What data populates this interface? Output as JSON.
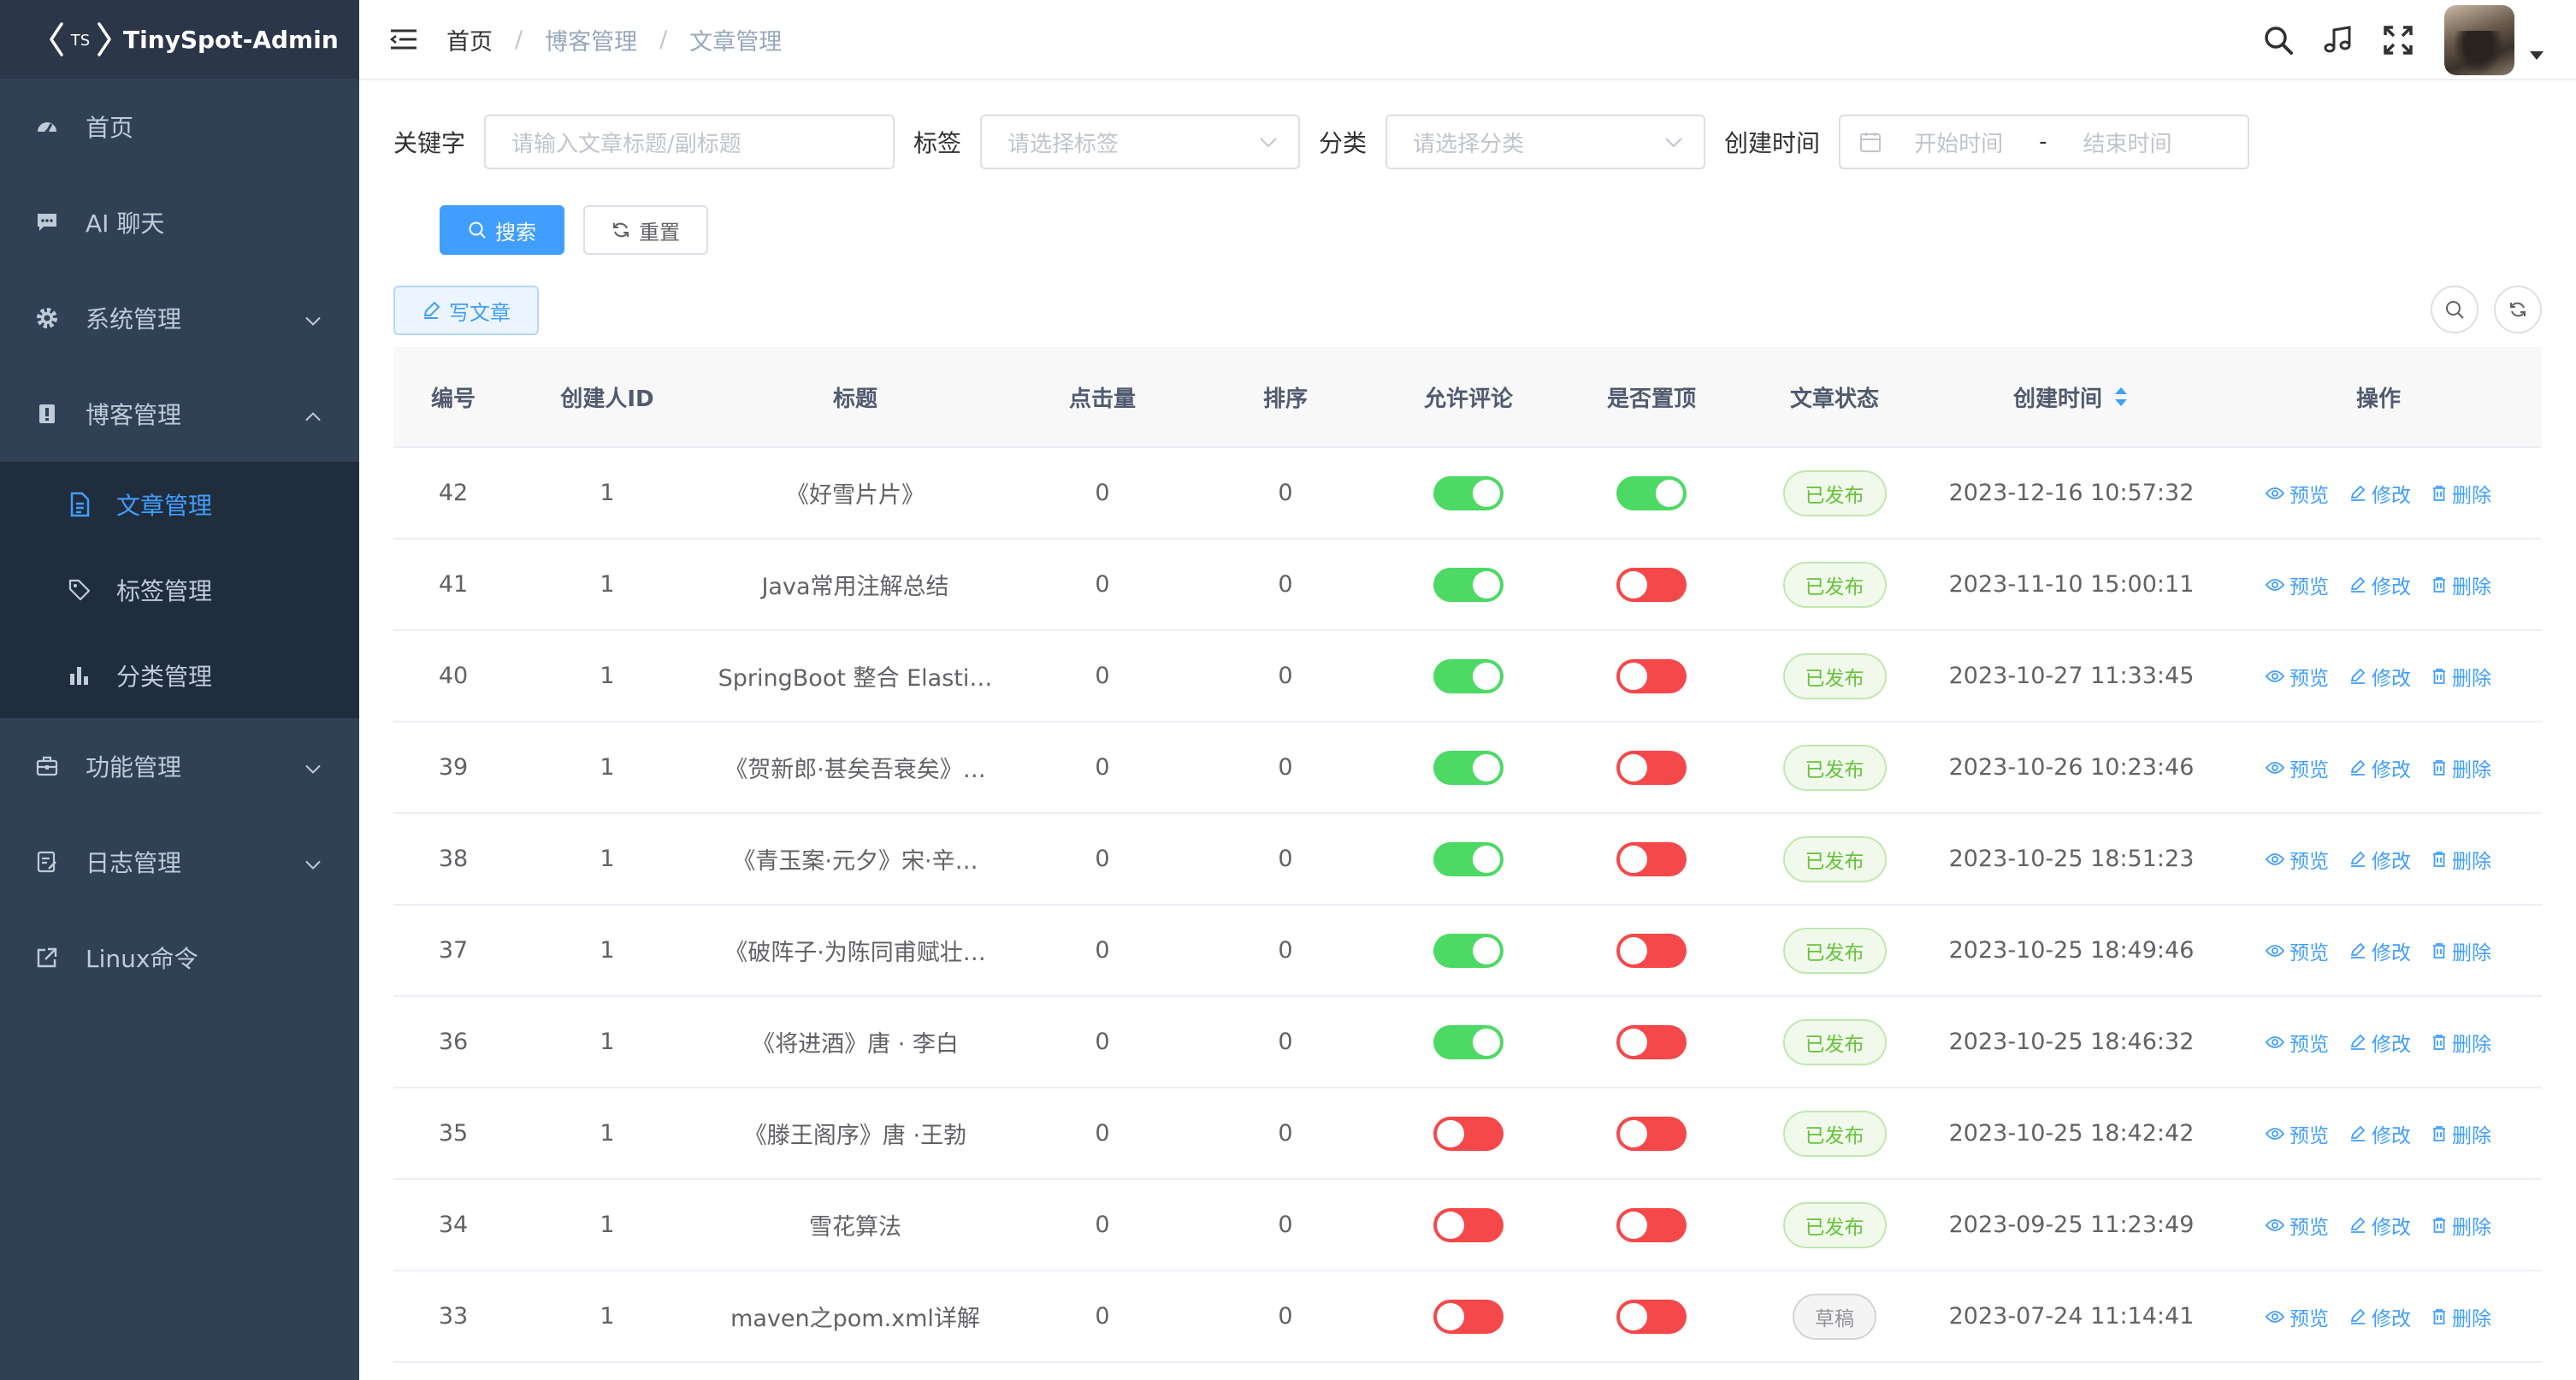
{
  "app": {
    "logo_text": "TinySpot-Admin",
    "logo_mark": "TS"
  },
  "sidebar": {
    "items": [
      {
        "label": "首页",
        "icon": "dashboard-icon"
      },
      {
        "label": "AI 聊天",
        "icon": "chat-icon"
      },
      {
        "label": "系统管理",
        "icon": "gear-icon",
        "expandable": true,
        "expanded": false
      },
      {
        "label": "博客管理",
        "icon": "blog-icon",
        "expandable": true,
        "expanded": true
      },
      {
        "label": "功能管理",
        "icon": "toolbox-icon",
        "expandable": true,
        "expanded": false
      },
      {
        "label": "日志管理",
        "icon": "log-icon",
        "expandable": true,
        "expanded": false
      },
      {
        "label": "Linux命令",
        "icon": "external-link-icon"
      }
    ],
    "blog_submenu": [
      {
        "label": "文章管理",
        "icon": "document-icon",
        "active": true
      },
      {
        "label": "标签管理",
        "icon": "tag-icon",
        "active": false
      },
      {
        "label": "分类管理",
        "icon": "bar-chart-icon",
        "active": false
      }
    ]
  },
  "header": {
    "breadcrumb": [
      "首页",
      "博客管理",
      "文章管理"
    ],
    "separator": "/",
    "icons": [
      "search-icon",
      "music-icon",
      "fullscreen-icon"
    ]
  },
  "filters": {
    "keyword_label": "关键字",
    "keyword_placeholder": "请输入文章标题/副标题",
    "tag_label": "标签",
    "tag_placeholder": "请选择标签",
    "category_label": "分类",
    "category_placeholder": "请选择分类",
    "created_label": "创建时间",
    "start_placeholder": "开始时间",
    "range_sep": "-",
    "end_placeholder": "结束时间",
    "search_button": "搜索",
    "reset_button": "重置"
  },
  "toolbar": {
    "write_button": "写文章"
  },
  "table": {
    "columns": [
      "编号",
      "创建人ID",
      "标题",
      "点击量",
      "排序",
      "允许评论",
      "是否置顶",
      "文章状态",
      "创建时间",
      "操作"
    ],
    "ops": {
      "preview": "预览",
      "edit": "修改",
      "delete": "删除"
    },
    "rows": [
      {
        "id": "42",
        "creator": "1",
        "title": "《好雪片片》",
        "clicks": "0",
        "sort": "0",
        "comment": true,
        "top": true,
        "status": "已发布",
        "created": "2023-12-16 10:57:32"
      },
      {
        "id": "41",
        "creator": "1",
        "title": "Java常用注解总结",
        "clicks": "0",
        "sort": "0",
        "comment": true,
        "top": false,
        "status": "已发布",
        "created": "2023-11-10 15:00:11"
      },
      {
        "id": "40",
        "creator": "1",
        "title": "SpringBoot 整合 Elasti…",
        "clicks": "0",
        "sort": "0",
        "comment": true,
        "top": false,
        "status": "已发布",
        "created": "2023-10-27 11:33:45"
      },
      {
        "id": "39",
        "creator": "1",
        "title": "《贺新郎·甚矣吾衰矣》…",
        "clicks": "0",
        "sort": "0",
        "comment": true,
        "top": false,
        "status": "已发布",
        "created": "2023-10-26 10:23:46"
      },
      {
        "id": "38",
        "creator": "1",
        "title": "《青玉案·元夕》宋·辛…",
        "clicks": "0",
        "sort": "0",
        "comment": true,
        "top": false,
        "status": "已发布",
        "created": "2023-10-25 18:51:23"
      },
      {
        "id": "37",
        "creator": "1",
        "title": "《破阵子·为陈同甫赋壮…",
        "clicks": "0",
        "sort": "0",
        "comment": true,
        "top": false,
        "status": "已发布",
        "created": "2023-10-25 18:49:46"
      },
      {
        "id": "36",
        "creator": "1",
        "title": "《将进酒》唐 · 李白",
        "clicks": "0",
        "sort": "0",
        "comment": true,
        "top": false,
        "status": "已发布",
        "created": "2023-10-25 18:46:32"
      },
      {
        "id": "35",
        "creator": "1",
        "title": "《滕王阁序》唐 ·王勃",
        "clicks": "0",
        "sort": "0",
        "comment": false,
        "top": false,
        "status": "已发布",
        "created": "2023-10-25 18:42:42"
      },
      {
        "id": "34",
        "creator": "1",
        "title": "雪花算法",
        "clicks": "0",
        "sort": "0",
        "comment": false,
        "top": false,
        "status": "已发布",
        "created": "2023-09-25 11:23:49"
      },
      {
        "id": "33",
        "creator": "1",
        "title": "maven之pom.xml详解",
        "clicks": "0",
        "sort": "0",
        "comment": false,
        "top": false,
        "status": "草稿",
        "created": "2023-07-24 11:14:41"
      }
    ]
  },
  "colors": {
    "sidebar_bg": "#304156",
    "submenu_bg": "#1f2d3d",
    "accent": "#409eff",
    "switch_on": "#4cd964",
    "switch_off": "#f5484a",
    "tag_published": "#67c23a",
    "tag_draft": "#909399"
  }
}
